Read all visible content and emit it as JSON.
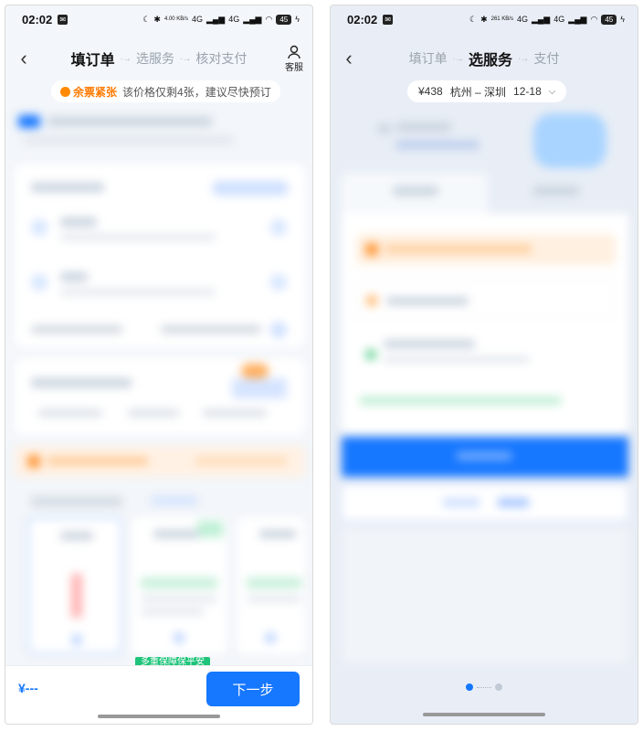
{
  "status": {
    "time": "02:02",
    "speed_left": "4.00 KB/s",
    "speed_right": "261 KB/s",
    "network": "4G",
    "battery": "45"
  },
  "colors": {
    "accent": "#1677ff",
    "warning": "#ff7a00",
    "success": "#1ec47a"
  },
  "left": {
    "steps": [
      "填订单",
      "选服务",
      "核对支付"
    ],
    "active_step": 0,
    "service_label": "客服",
    "tip": {
      "hot_label": "余票紧张",
      "text": "该价格仅剩4张，建议尽快预订"
    },
    "price_placeholder": "¥---",
    "next_label": "下一步",
    "green_tag": "多重保障保平安"
  },
  "right": {
    "steps": [
      "填订单",
      "选服务",
      "支付"
    ],
    "active_step": 1,
    "route": {
      "price": "¥438",
      "cities": "杭州 – 深圳",
      "date": "12-18"
    },
    "page_count": 2,
    "current_page": 0
  }
}
